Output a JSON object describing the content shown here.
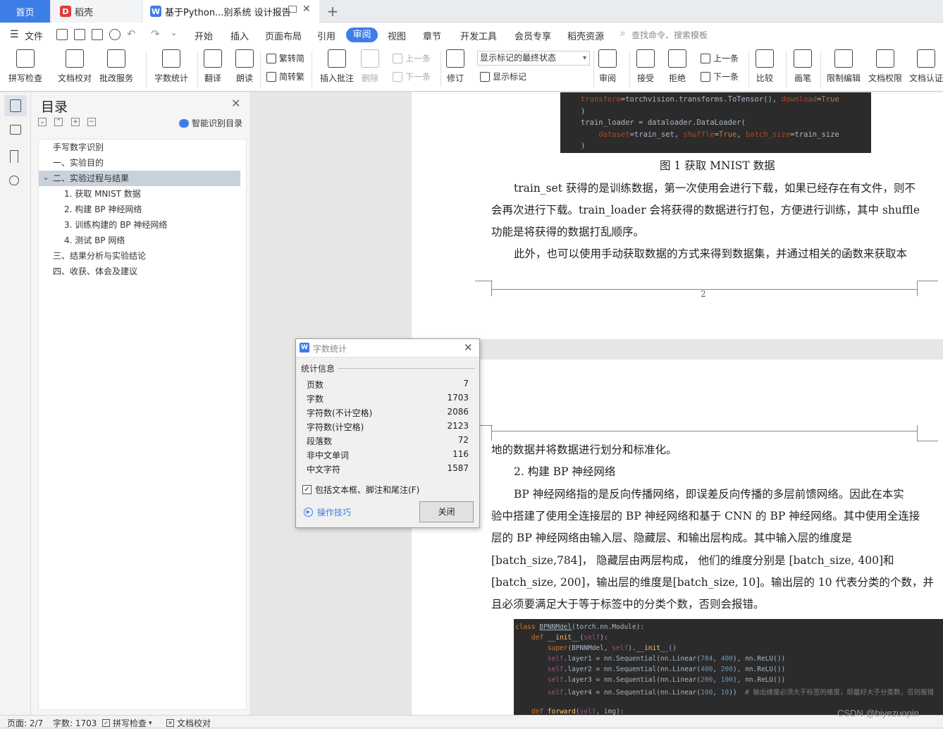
{
  "tabs": {
    "home": "首页",
    "daoke": "稻壳",
    "document": "基于Python...别系统 设计报告",
    "new_tab": "+"
  },
  "menu": {
    "file": "文件",
    "items": [
      "开始",
      "插入",
      "页面布局",
      "引用",
      "审阅",
      "视图",
      "章节",
      "开发工具",
      "会员专享",
      "稻壳资源"
    ],
    "active": "审阅",
    "search_placeholder": "查找命令、搜索模板"
  },
  "ribbon": {
    "spell_check": "拼写检查",
    "doc_proof": "文档校对",
    "review_service": "批改服务",
    "word_count": "字数统计",
    "translate": "翻译",
    "read_aloud": "朗读",
    "trad_to_simp": "繁转简",
    "simp_to_trad": "简转繁",
    "insert_comment": "插入批注",
    "delete": "删除",
    "prev_comment": "上一条",
    "next_comment": "下一条",
    "track_changes": "修订",
    "markup_state": "显示标记的最终状态",
    "show_markup": "显示标记",
    "review_pane": "审阅",
    "accept": "接受",
    "reject": "拒绝",
    "prev_change": "上一条",
    "next_change": "下一条",
    "compare": "比较",
    "pen": "画笔",
    "restrict_edit": "限制编辑",
    "doc_permission": "文档权限",
    "doc_auth": "文档认证"
  },
  "toc": {
    "title": "目录",
    "smart_label": "智能识别目录",
    "items": [
      {
        "label": "手写数字识别",
        "level": 0
      },
      {
        "label": "一、实验目的",
        "level": 0
      },
      {
        "label": "二、实验过程与结果",
        "level": 0
      },
      {
        "label": "1. 获取 MNIST 数据",
        "level": 1
      },
      {
        "label": "2. 构建 BP 神经网络",
        "level": 1
      },
      {
        "label": "3. 训练构建的 BP 神经网络",
        "level": 1
      },
      {
        "label": "4. 测试 BP 网络",
        "level": 1
      },
      {
        "label": "三、结果分析与实验结论",
        "level": 0
      },
      {
        "label": "四、收获、体会及建议",
        "level": 0
      }
    ],
    "selected_index": 2
  },
  "document": {
    "code1": [
      "    transform=torchvision.transforms.ToTensor(), download=True",
      ")",
      "train_loader = dataloader.DataLoader(",
      "    dataset=train_set, shuffle=True, batch_size=train_size",
      ")"
    ],
    "figure_caption": "图 1  获取 MNIST 数据",
    "para1": [
      "train_set 获得的是训练数据，第一次使用会进行下载，如果已经存在有文件，则不",
      "会再次进行下载。train_loader 会将获得的数据进行打包，方便进行训练，其中 shuffle",
      "功能是将获得的数据打乱顺序。"
    ],
    "para2": "此外，也可以使用手动获取数据的方式来得到数据集，并通过相关的函数来获取本",
    "page_number": "2",
    "para2_cont": "地的数据并将数据进行划分和标准化。",
    "heading2": "2. 构建 BP 神经网络",
    "para3": [
      "BP 神经网络指的是反向传播网络，即误差反向传播的多层前馈网络。因此在本实",
      "验中搭建了使用全连接层的 BP 神经网络和基于 CNN 的 BP 神经网络。其中使用全连接",
      "层的 BP 神经网络由输入层、隐藏层、和输出层构成。其中输入层的维度是",
      "[batch_size,784]， 隐藏层由两层构成， 他们的维度分别是 [batch_size, 400]和",
      "[batch_size, 200]，输出层的维度是[batch_size, 10]。输出层的 10 代表分类的个数，并",
      "且必须要满足大于等于标签中的分类个数，否则会报错。"
    ],
    "code2": [
      "class BPNNMdel(torch.nn.Module):",
      "    def __init__(self):",
      "        super(BPNNMdel, self).__init__()",
      "        self.layer1 = nn.Sequential(nn.Linear(784, 400), nn.ReLU())",
      "        self.layer2 = nn.Sequential(nn.Linear(400, 200), nn.ReLU())",
      "        self.layer3 = nn.Sequential(nn.Linear(200, 100), nn.ReLU())",
      "        self.layer4 = nn.Sequential(nn.Linear(100, 10))  # 输出维度必须大于标签的维度，即最好大于分类数，否则报错",
      "",
      "    def forward(self, img):"
    ]
  },
  "dialog": {
    "title": "字数统计",
    "section": "统计信息",
    "stats": [
      {
        "label": "页数",
        "value": "7"
      },
      {
        "label": "字数",
        "value": "1703"
      },
      {
        "label": "字符数(不计空格)",
        "value": "2086"
      },
      {
        "label": "字符数(计空格)",
        "value": "2123"
      },
      {
        "label": "段落数",
        "value": "72"
      },
      {
        "label": "非中文单词",
        "value": "116"
      },
      {
        "label": "中文字符",
        "value": "1587"
      }
    ],
    "include_label": "包括文本框、脚注和尾注(F)",
    "include_checked": true,
    "tips": "操作技巧",
    "close": "关闭"
  },
  "status": {
    "page": "页面: 2/7",
    "words": "字数: 1703",
    "spell": "拼写检查",
    "proof": "文档校对"
  },
  "watermark": "CSDN @biyezuopin",
  "colors": {
    "accent": "#3d7de8",
    "code_bg": "#2b2b2b"
  }
}
